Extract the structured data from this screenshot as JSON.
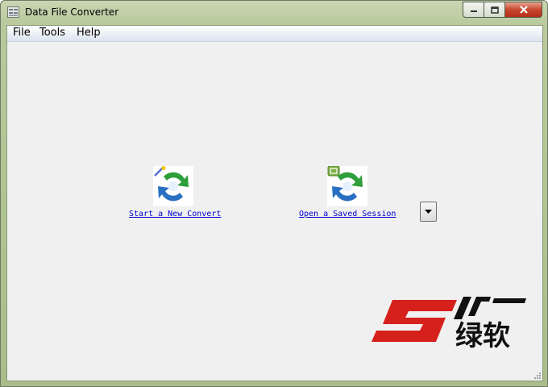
{
  "window": {
    "title": "Data File Converter",
    "controls": {
      "minimize": "minimize",
      "maximize": "maximize",
      "close": "close"
    }
  },
  "menu": {
    "items": [
      {
        "label": "File"
      },
      {
        "label": "Tools"
      },
      {
        "label": "Help"
      }
    ]
  },
  "actions": {
    "new_convert": {
      "label": "Start a New Convert",
      "icon": "convert-new-icon"
    },
    "open_session": {
      "label": "Open a Saved Session",
      "icon": "convert-open-icon"
    },
    "dropdown": {
      "icon": "triangle-down-icon"
    }
  },
  "watermark": {
    "text": "绿软",
    "icon": "sr-logo"
  },
  "colors": {
    "link": "#0000cc",
    "client_bg": "#f0f0f0",
    "titlebar": "#b8c99c",
    "close_button": "#c7452c",
    "watermark_red": "#d6201c"
  }
}
